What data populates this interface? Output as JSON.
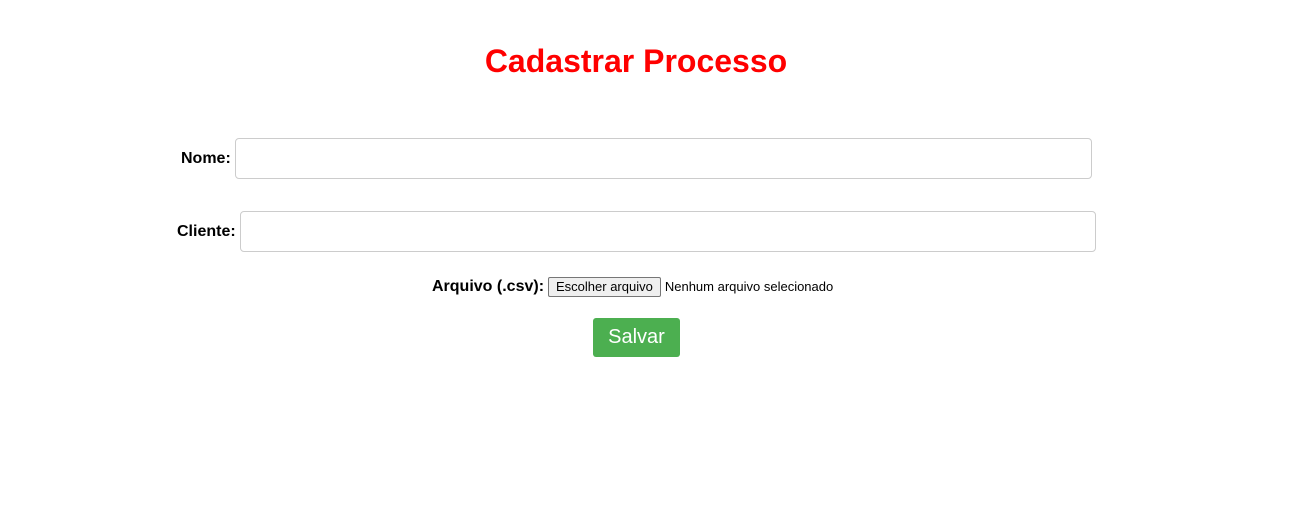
{
  "page": {
    "title": "Cadastrar Processo"
  },
  "form": {
    "nome": {
      "label": "Nome:",
      "value": "",
      "placeholder": ""
    },
    "cliente": {
      "label": "Cliente:",
      "value": "",
      "placeholder": ""
    },
    "arquivo": {
      "label": "Arquivo (.csv):",
      "button_label": "Escolher arquivo",
      "status": "Nenhum arquivo selecionado"
    },
    "save_label": "Salvar"
  },
  "colors": {
    "title": "#ff0000",
    "save_button": "#4caf50",
    "input_border": "#cccccc"
  }
}
